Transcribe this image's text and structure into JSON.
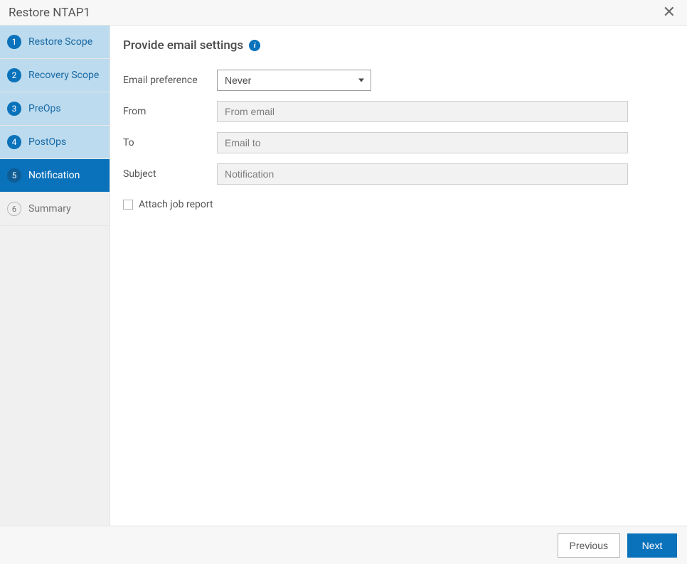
{
  "title": "Restore NTAP1",
  "steps": [
    {
      "num": "1",
      "label": "Restore Scope",
      "state": "completed"
    },
    {
      "num": "2",
      "label": "Recovery Scope",
      "state": "completed"
    },
    {
      "num": "3",
      "label": "PreOps",
      "state": "completed"
    },
    {
      "num": "4",
      "label": "PostOps",
      "state": "completed"
    },
    {
      "num": "5",
      "label": "Notification",
      "state": "active"
    },
    {
      "num": "6",
      "label": "Summary",
      "state": "upcoming"
    }
  ],
  "main": {
    "heading": "Provide email settings",
    "fields": {
      "email_pref_label": "Email preference",
      "email_pref_value": "Never",
      "from_label": "From",
      "from_placeholder": "From email",
      "to_label": "To",
      "to_placeholder": "Email to",
      "subject_label": "Subject",
      "subject_placeholder": "Notification",
      "attach_label": "Attach job report"
    }
  },
  "footer": {
    "prev": "Previous",
    "next": "Next"
  }
}
